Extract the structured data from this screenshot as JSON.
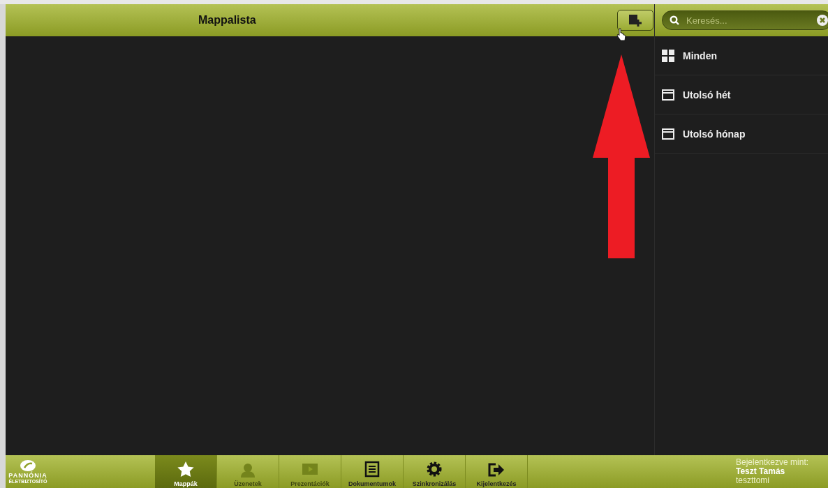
{
  "header": {
    "title": "Mappalista"
  },
  "search": {
    "placeholder": "Keresés..."
  },
  "filters": [
    {
      "label": "Minden",
      "kind": "grid"
    },
    {
      "label": "Utolsó hét",
      "kind": "calendar"
    },
    {
      "label": "Utolsó hónap",
      "kind": "calendar"
    }
  ],
  "logo": {
    "name": "PANNÓNIA",
    "subtitle": "ÉLETBIZTOSÍTÓ"
  },
  "nav": [
    {
      "label": "Mappák",
      "kind": "star",
      "selected": true,
      "disabled": false
    },
    {
      "label": "Üzenetek",
      "kind": "people",
      "selected": false,
      "disabled": true
    },
    {
      "label": "Prezentációk",
      "kind": "play",
      "selected": false,
      "disabled": true
    },
    {
      "label": "Dokumentumok",
      "kind": "document",
      "selected": false,
      "disabled": false
    },
    {
      "label": "Szinkronizálás",
      "kind": "gear",
      "selected": false,
      "disabled": false
    },
    {
      "label": "Kijelentkezés",
      "kind": "exit",
      "selected": false,
      "disabled": false
    }
  ],
  "login": {
    "caption": "Bejelentkezve mint:",
    "name": "Teszt Tamás",
    "username": "teszttomi"
  }
}
